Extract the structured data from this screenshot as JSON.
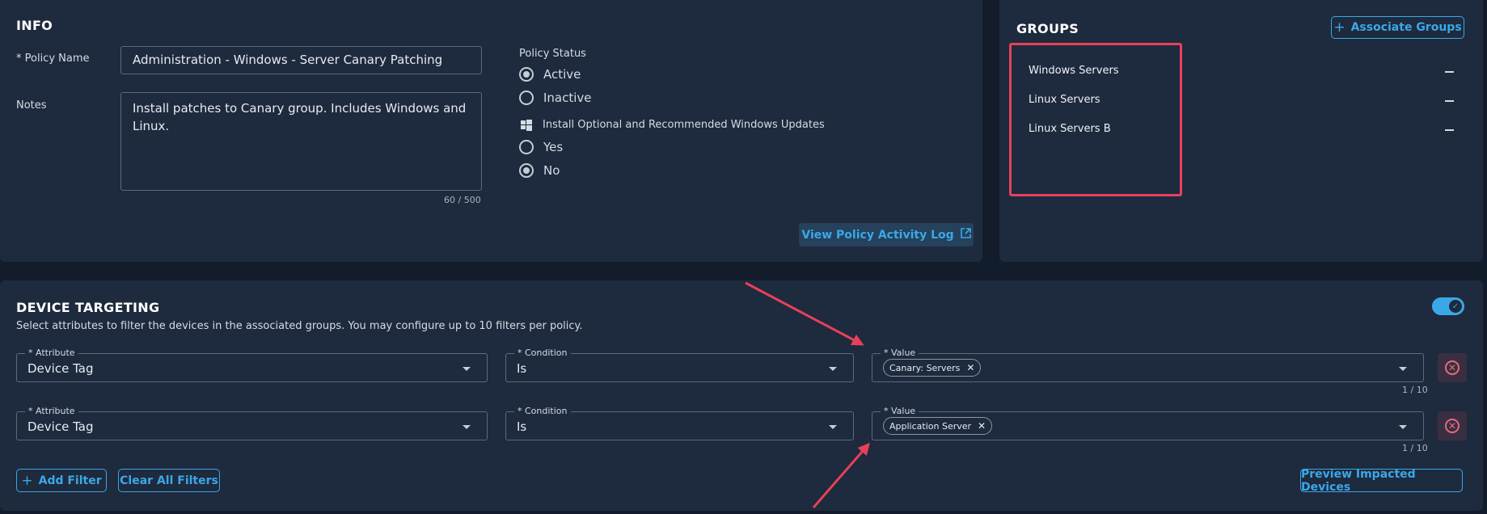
{
  "info": {
    "title": "INFO",
    "policy_name_label": "* Policy Name",
    "policy_name_value": "Administration - Windows - Server Canary Patching",
    "notes_label": "Notes",
    "notes_value": "Install patches to Canary group. Includes Windows and Linux.",
    "notes_counter": "60 / 500",
    "policy_status_label": "Policy Status",
    "status_options": [
      "Active",
      "Inactive"
    ],
    "status_selected": "Active",
    "windows_updates_label": "Install Optional and Recommended Windows Updates",
    "windows_updates_options": [
      "Yes",
      "No"
    ],
    "windows_updates_selected": "No",
    "activity_log_button": "View Policy Activity Log"
  },
  "groups": {
    "title": "GROUPS",
    "associate_button": "Associate Groups",
    "items": [
      "Windows Servers",
      "Linux Servers",
      "Linux Servers B"
    ]
  },
  "targeting": {
    "title": "DEVICE TARGETING",
    "description": "Select attributes to filter the devices in the associated groups. You may configure up to 10 filters per policy.",
    "enabled": true,
    "attribute_label": "* Attribute",
    "condition_label": "* Condition",
    "value_label": "* Value",
    "filters": [
      {
        "attribute": "Device Tag",
        "condition": "Is",
        "value_chip": "Canary: Servers",
        "count": "1 / 10"
      },
      {
        "attribute": "Device Tag",
        "condition": "Is",
        "value_chip": "Application Server",
        "count": "1 / 10"
      }
    ],
    "add_filter_button": "Add Filter",
    "clear_filters_button": "Clear All Filters",
    "preview_button": "Preview Impacted Devices"
  },
  "colors": {
    "accent": "#3aa8e8",
    "panel": "#1e2a3d",
    "background": "#131c2a",
    "annotation": "#e8405a"
  }
}
